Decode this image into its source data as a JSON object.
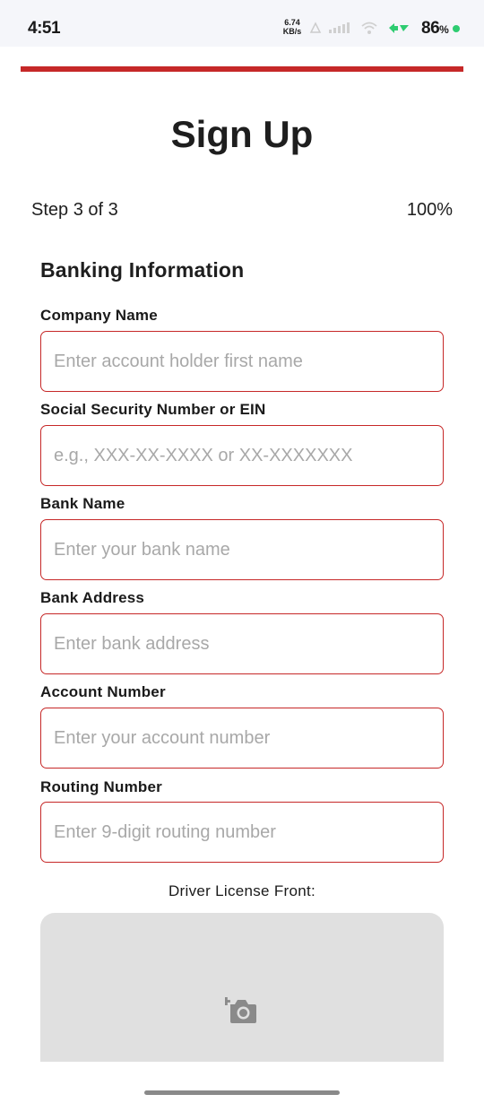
{
  "status_bar": {
    "time": "4:51",
    "net_speed_value": "6.74",
    "net_speed_unit": "KB/s",
    "battery": "86",
    "battery_unit": "%"
  },
  "progress": {
    "percent": 100,
    "color": "#c62828"
  },
  "header": {
    "title": "Sign Up"
  },
  "step": {
    "label": "Step 3 of 3",
    "percent_label": "100%"
  },
  "section": {
    "title": "Banking Information"
  },
  "fields": [
    {
      "label": "Company Name",
      "placeholder": "Enter account holder first name",
      "value": ""
    },
    {
      "label": "Social Security Number or EIN",
      "placeholder": "e.g., XXX-XX-XXXX or XX-XXXXXXX",
      "value": ""
    },
    {
      "label": "Bank Name",
      "placeholder": "Enter your bank name",
      "value": ""
    },
    {
      "label": "Bank Address",
      "placeholder": "Enter bank address",
      "value": ""
    },
    {
      "label": "Account Number",
      "placeholder": "Enter your account number",
      "value": ""
    },
    {
      "label": "Routing Number",
      "placeholder": "Enter 9-digit routing number",
      "value": ""
    }
  ],
  "upload": {
    "label": "Driver License Front:",
    "icon": "add-a-photo-icon"
  },
  "colors": {
    "accent": "#c62828",
    "placeholder": "#a8a8a8",
    "upload_bg": "#e0e0e0"
  }
}
